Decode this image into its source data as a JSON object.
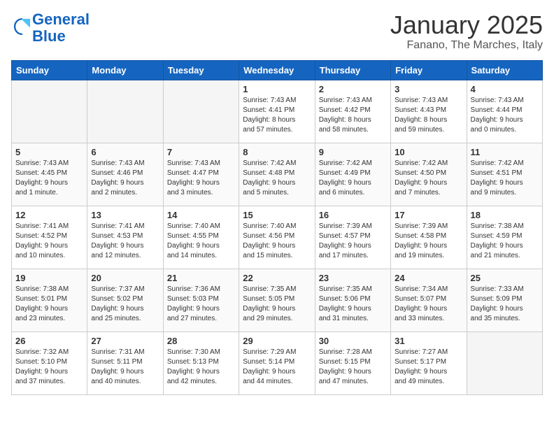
{
  "header": {
    "logo_general": "General",
    "logo_blue": "Blue",
    "month_title": "January 2025",
    "location": "Fanano, The Marches, Italy"
  },
  "weekdays": [
    "Sunday",
    "Monday",
    "Tuesday",
    "Wednesday",
    "Thursday",
    "Friday",
    "Saturday"
  ],
  "weeks": [
    [
      {
        "day": "",
        "info": ""
      },
      {
        "day": "",
        "info": ""
      },
      {
        "day": "",
        "info": ""
      },
      {
        "day": "1",
        "info": "Sunrise: 7:43 AM\nSunset: 4:41 PM\nDaylight: 8 hours\nand 57 minutes."
      },
      {
        "day": "2",
        "info": "Sunrise: 7:43 AM\nSunset: 4:42 PM\nDaylight: 8 hours\nand 58 minutes."
      },
      {
        "day": "3",
        "info": "Sunrise: 7:43 AM\nSunset: 4:43 PM\nDaylight: 8 hours\nand 59 minutes."
      },
      {
        "day": "4",
        "info": "Sunrise: 7:43 AM\nSunset: 4:44 PM\nDaylight: 9 hours\nand 0 minutes."
      }
    ],
    [
      {
        "day": "5",
        "info": "Sunrise: 7:43 AM\nSunset: 4:45 PM\nDaylight: 9 hours\nand 1 minute."
      },
      {
        "day": "6",
        "info": "Sunrise: 7:43 AM\nSunset: 4:46 PM\nDaylight: 9 hours\nand 2 minutes."
      },
      {
        "day": "7",
        "info": "Sunrise: 7:43 AM\nSunset: 4:47 PM\nDaylight: 9 hours\nand 3 minutes."
      },
      {
        "day": "8",
        "info": "Sunrise: 7:42 AM\nSunset: 4:48 PM\nDaylight: 9 hours\nand 5 minutes."
      },
      {
        "day": "9",
        "info": "Sunrise: 7:42 AM\nSunset: 4:49 PM\nDaylight: 9 hours\nand 6 minutes."
      },
      {
        "day": "10",
        "info": "Sunrise: 7:42 AM\nSunset: 4:50 PM\nDaylight: 9 hours\nand 7 minutes."
      },
      {
        "day": "11",
        "info": "Sunrise: 7:42 AM\nSunset: 4:51 PM\nDaylight: 9 hours\nand 9 minutes."
      }
    ],
    [
      {
        "day": "12",
        "info": "Sunrise: 7:41 AM\nSunset: 4:52 PM\nDaylight: 9 hours\nand 10 minutes."
      },
      {
        "day": "13",
        "info": "Sunrise: 7:41 AM\nSunset: 4:53 PM\nDaylight: 9 hours\nand 12 minutes."
      },
      {
        "day": "14",
        "info": "Sunrise: 7:40 AM\nSunset: 4:55 PM\nDaylight: 9 hours\nand 14 minutes."
      },
      {
        "day": "15",
        "info": "Sunrise: 7:40 AM\nSunset: 4:56 PM\nDaylight: 9 hours\nand 15 minutes."
      },
      {
        "day": "16",
        "info": "Sunrise: 7:39 AM\nSunset: 4:57 PM\nDaylight: 9 hours\nand 17 minutes."
      },
      {
        "day": "17",
        "info": "Sunrise: 7:39 AM\nSunset: 4:58 PM\nDaylight: 9 hours\nand 19 minutes."
      },
      {
        "day": "18",
        "info": "Sunrise: 7:38 AM\nSunset: 4:59 PM\nDaylight: 9 hours\nand 21 minutes."
      }
    ],
    [
      {
        "day": "19",
        "info": "Sunrise: 7:38 AM\nSunset: 5:01 PM\nDaylight: 9 hours\nand 23 minutes."
      },
      {
        "day": "20",
        "info": "Sunrise: 7:37 AM\nSunset: 5:02 PM\nDaylight: 9 hours\nand 25 minutes."
      },
      {
        "day": "21",
        "info": "Sunrise: 7:36 AM\nSunset: 5:03 PM\nDaylight: 9 hours\nand 27 minutes."
      },
      {
        "day": "22",
        "info": "Sunrise: 7:35 AM\nSunset: 5:05 PM\nDaylight: 9 hours\nand 29 minutes."
      },
      {
        "day": "23",
        "info": "Sunrise: 7:35 AM\nSunset: 5:06 PM\nDaylight: 9 hours\nand 31 minutes."
      },
      {
        "day": "24",
        "info": "Sunrise: 7:34 AM\nSunset: 5:07 PM\nDaylight: 9 hours\nand 33 minutes."
      },
      {
        "day": "25",
        "info": "Sunrise: 7:33 AM\nSunset: 5:09 PM\nDaylight: 9 hours\nand 35 minutes."
      }
    ],
    [
      {
        "day": "26",
        "info": "Sunrise: 7:32 AM\nSunset: 5:10 PM\nDaylight: 9 hours\nand 37 minutes."
      },
      {
        "day": "27",
        "info": "Sunrise: 7:31 AM\nSunset: 5:11 PM\nDaylight: 9 hours\nand 40 minutes."
      },
      {
        "day": "28",
        "info": "Sunrise: 7:30 AM\nSunset: 5:13 PM\nDaylight: 9 hours\nand 42 minutes."
      },
      {
        "day": "29",
        "info": "Sunrise: 7:29 AM\nSunset: 5:14 PM\nDaylight: 9 hours\nand 44 minutes."
      },
      {
        "day": "30",
        "info": "Sunrise: 7:28 AM\nSunset: 5:15 PM\nDaylight: 9 hours\nand 47 minutes."
      },
      {
        "day": "31",
        "info": "Sunrise: 7:27 AM\nSunset: 5:17 PM\nDaylight: 9 hours\nand 49 minutes."
      },
      {
        "day": "",
        "info": ""
      }
    ]
  ]
}
